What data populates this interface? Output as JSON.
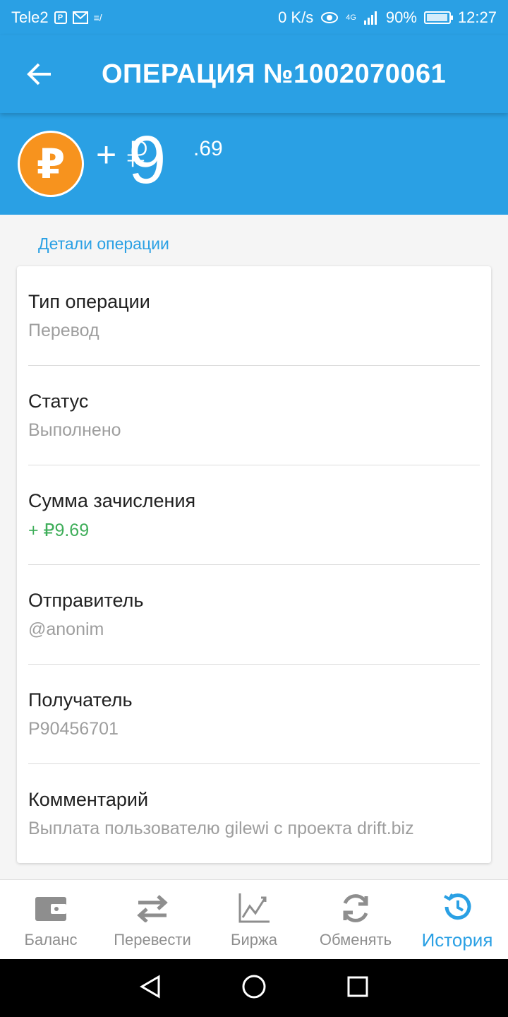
{
  "status_bar": {
    "carrier": "Tele2",
    "speed": "0 K/s",
    "network": "4G",
    "battery": "90%",
    "time": "12:27"
  },
  "app_bar": {
    "title": "ОПЕРАЦИЯ №1002070061",
    "back_icon": "arrow-left-icon"
  },
  "amount": {
    "currency_icon": "ruble-coin-icon",
    "sign": "+",
    "symbol": "₽",
    "integer": "9",
    "fraction": ".69"
  },
  "details": {
    "section_title": "Детали операции",
    "rows": [
      {
        "label": "Тип операции",
        "value": "Перевод"
      },
      {
        "label": "Статус",
        "value": "Выполнено"
      },
      {
        "label": "Сумма зачисления",
        "value": "+ ₽9.69"
      },
      {
        "label": "Отправитель",
        "value": "@anonim"
      },
      {
        "label": "Получатель",
        "value": "P90456701"
      },
      {
        "label": "Комментарий",
        "value": "Выплата пользователю gilewi с проекта drift.biz"
      }
    ]
  },
  "bottom_nav": {
    "items": [
      {
        "label": "Баланс",
        "icon": "wallet-icon"
      },
      {
        "label": "Перевести",
        "icon": "transfer-arrows-icon"
      },
      {
        "label": "Биржа",
        "icon": "chart-icon"
      },
      {
        "label": "Обменять",
        "icon": "exchange-icon"
      },
      {
        "label": "История",
        "icon": "history-icon"
      }
    ],
    "active": "История"
  },
  "colors": {
    "primary": "#2aa0e4",
    "coin": "#f7931e",
    "positive": "#3fae5a"
  }
}
